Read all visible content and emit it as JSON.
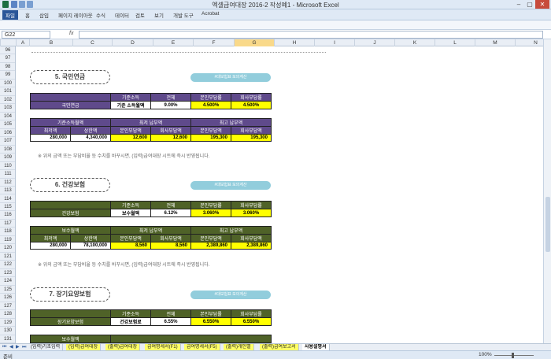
{
  "window": {
    "title": "엑셀급여대장 2016-2 작성예1 - Microsoft Excel",
    "minimize": "–",
    "maximize": "▢",
    "close": "✕"
  },
  "ribbon_tabs": [
    "파일",
    "홈",
    "삽입",
    "페이지 레이아웃",
    "수식",
    "데이터",
    "검토",
    "보기",
    "개발 도구",
    "Acrobat"
  ],
  "formula_bar": {
    "name_box": "G22",
    "fx": "fx",
    "formula": ""
  },
  "columns": [
    "A",
    "B",
    "C",
    "D",
    "E",
    "F",
    "G",
    "H",
    "I",
    "J",
    "K",
    "L",
    "M",
    "N"
  ],
  "selected_column": "G",
  "rows": [
    "96",
    "97",
    "98",
    "99",
    "100",
    "101",
    "102",
    "103",
    "104",
    "105",
    "106",
    "107",
    "108",
    "109",
    "110",
    "111",
    "112",
    "113",
    "114",
    "115",
    "116",
    "117",
    "118",
    "119",
    "120",
    "121",
    "122",
    "123",
    "124",
    "125",
    "126",
    "127",
    "128",
    "129",
    "130",
    "131"
  ],
  "sections": [
    {
      "title": "5. 국민연금",
      "calc_button": "#대보험표 모의계산",
      "rate_table": {
        "headers": [
          "기준소득",
          "전체",
          "본인부담률",
          "회사부담률"
        ],
        "row": {
          "label": "국민연금",
          "base": "기준 소득월액",
          "total": "9.00%",
          "employee": "4.500%",
          "employer": "4.500%"
        }
      },
      "pay_table": {
        "group1": "기준소득월액",
        "group2": "최저 납부액",
        "group3": "최고 납부액",
        "sub": [
          "최저액",
          "상한액",
          "본인부담액",
          "회사부담액",
          "본인부담액",
          "회사부담액"
        ],
        "values": [
          "280,000",
          "4,340,000",
          "12,600",
          "12,600",
          "195,300",
          "195,300"
        ]
      },
      "note": "※ 위의 금액 또는 부담비율 등 수치를 바꾸시면, (입력)급여대장 시트에 즉시 반영됩니다."
    },
    {
      "title": "6. 건강보험",
      "calc_button": "#대보험표 모의계산",
      "rate_table": {
        "headers": [
          "기준소득",
          "전체",
          "본인부담률",
          "회사부담률"
        ],
        "row": {
          "label": "건강보험",
          "base": "보수월액",
          "total": "6.12%",
          "employee": "3.060%",
          "employer": "3.060%"
        }
      },
      "pay_table": {
        "group1": "보수월액",
        "group2": "최저 납부액",
        "group3": "최고 납부액",
        "sub": [
          "최저액",
          "상한액",
          "본인부담액",
          "회사부담액",
          "본인부담액",
          "회사부담액"
        ],
        "values": [
          "280,000",
          "78,100,000",
          "8,560",
          "8,560",
          "2,389,860",
          "2,389,860"
        ]
      },
      "note": "※ 위의 금액 또는 부담비율 등 수치를 바꾸시면, (입력)급여대장 시트에 즉시 반영됩니다."
    },
    {
      "title": "7. 장기요양보험",
      "calc_button": "#대보험표 모의계산",
      "rate_table": {
        "headers": [
          "기준소득",
          "전체",
          "본인부담률",
          "회사부담률"
        ],
        "row": {
          "label": "장기요양보험",
          "base": "건강보험료",
          "total": "6.55%",
          "employee": "6.550%",
          "employer": "6.550%"
        }
      },
      "pay_table_head": "보수월액"
    }
  ],
  "sheet_tabs": [
    {
      "label": "(입력)기초입력",
      "style": "normal"
    },
    {
      "label": "(입력)급여대장",
      "style": "hl"
    },
    {
      "label": "(출력)급여대장",
      "style": "hl"
    },
    {
      "label": "급여명세서(F1)",
      "style": "hl"
    },
    {
      "label": "급여명세서(F5)",
      "style": "hl"
    },
    {
      "label": "(출력)개인별",
      "style": "hl"
    },
    {
      "label": "(출력)급여보고서",
      "style": "hl"
    },
    {
      "label": "사용설명서",
      "style": "active"
    }
  ],
  "status": {
    "ready": "준비",
    "zoom": "100%"
  },
  "colors": {
    "purple_header": "#5f4a8b",
    "green_header": "#4f6228",
    "yellow": "#ffff00",
    "button": "#92cddc"
  }
}
